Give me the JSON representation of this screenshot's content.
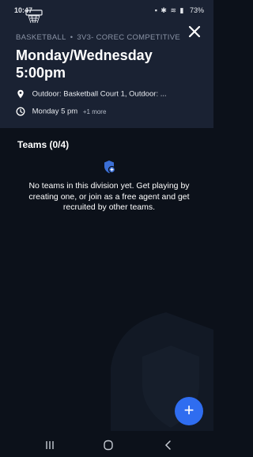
{
  "status_bar": {
    "time": "10:47",
    "battery": "73%"
  },
  "header": {
    "breadcrumb": {
      "sport": "BASKETBALL",
      "separator": "•",
      "division": "3V3- COREC COMPETITIVE"
    },
    "title": "Monday/Wednesday 5:00pm",
    "location": {
      "icon": "location-pin-icon",
      "text": "Outdoor: Basketball Court 1, Outdoor: ..."
    },
    "schedule": {
      "icon": "clock-icon",
      "text": "Monday 5 pm",
      "more": "+1 more"
    },
    "close_icon": "close-icon"
  },
  "teams": {
    "heading": "Teams (0/4)",
    "empty_icon": "shield-plus-icon",
    "empty_message": "No teams in this division yet. Get playing by creating one, or join as a free agent and get recruited by other teams."
  },
  "fab": {
    "label": "+",
    "icon": "add-icon"
  },
  "colors": {
    "background": "#0c111a",
    "header_background": "#1a2233",
    "accent": "#2f6df0",
    "muted_text": "#8b94a6"
  }
}
